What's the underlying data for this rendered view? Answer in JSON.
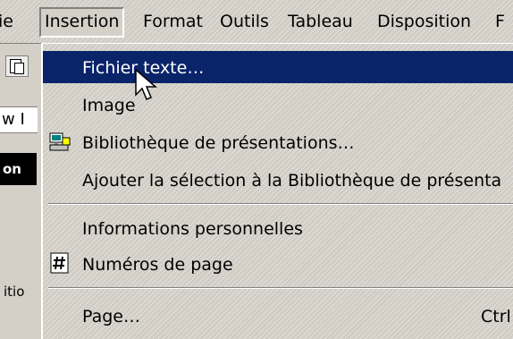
{
  "menubar": {
    "items": [
      {
        "label": "ie"
      },
      {
        "label": "Insertion"
      },
      {
        "label": "Format"
      },
      {
        "label": "Outils"
      },
      {
        "label": "Tableau"
      },
      {
        "label": "Disposition"
      },
      {
        "label": "F"
      }
    ]
  },
  "left": {
    "doc_text": "w I",
    "dark_text": "on",
    "bottom_text": "itio"
  },
  "menu": {
    "items": [
      {
        "label": "Fichier texte…",
        "highlighted": true
      },
      {
        "label": "Image"
      },
      {
        "label": "Bibliothèque de présentations…",
        "icon": "library-icon"
      },
      {
        "label": "Ajouter la sélection à la Bibliothèque de présenta"
      },
      {
        "label": "Informations personnelles"
      },
      {
        "label": "Numéros de page",
        "icon": "page-number-icon"
      },
      {
        "label": "Page…",
        "shortcut": "Ctrl"
      }
    ]
  },
  "colors": {
    "highlight": "#0a246a",
    "face": "#d4d0c8"
  }
}
